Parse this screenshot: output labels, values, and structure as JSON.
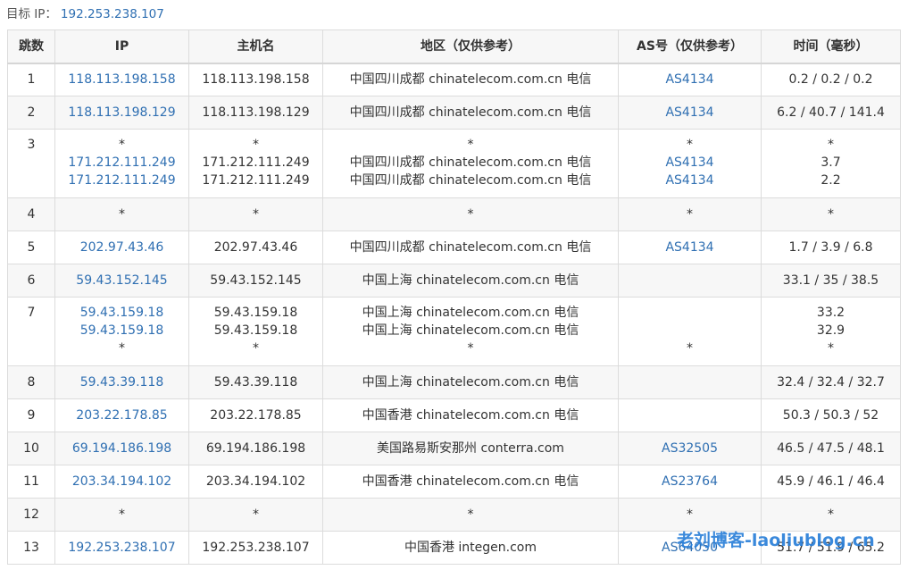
{
  "target": {
    "label": "目标 IP：",
    "ip": "192.253.238.107"
  },
  "headers": [
    "跳数",
    "IP",
    "主机名",
    "地区（仅供参考）",
    "AS号（仅供参考）",
    "时间（毫秒）"
  ],
  "rows": [
    {
      "hop": "1",
      "ip": [
        "118.113.198.158"
      ],
      "host": [
        "118.113.198.158"
      ],
      "region": [
        "中国四川成都 chinatelecom.com.cn 电信"
      ],
      "as": [
        "AS4134"
      ],
      "time": [
        "0.2 / 0.2 / 0.2"
      ]
    },
    {
      "hop": "2",
      "ip": [
        "118.113.198.129"
      ],
      "host": [
        "118.113.198.129"
      ],
      "region": [
        "中国四川成都 chinatelecom.com.cn 电信"
      ],
      "as": [
        "AS4134"
      ],
      "time": [
        "6.2 / 40.7 / 141.4"
      ]
    },
    {
      "hop": "3",
      "ip": [
        "*",
        "171.212.111.249",
        "171.212.111.249"
      ],
      "host": [
        "*",
        "171.212.111.249",
        "171.212.111.249"
      ],
      "region": [
        "*",
        "中国四川成都 chinatelecom.com.cn 电信",
        "中国四川成都 chinatelecom.com.cn 电信"
      ],
      "as": [
        "*",
        "AS4134",
        "AS4134"
      ],
      "time": [
        "*",
        "3.7",
        "2.2"
      ]
    },
    {
      "hop": "4",
      "ip": [
        "*"
      ],
      "host": [
        "*"
      ],
      "region": [
        "*"
      ],
      "as": [
        "*"
      ],
      "time": [
        "*"
      ]
    },
    {
      "hop": "5",
      "ip": [
        "202.97.43.46"
      ],
      "host": [
        "202.97.43.46"
      ],
      "region": [
        "中国四川成都 chinatelecom.com.cn 电信"
      ],
      "as": [
        "AS4134"
      ],
      "time": [
        "1.7 / 3.9 / 6.8"
      ]
    },
    {
      "hop": "6",
      "ip": [
        "59.43.152.145"
      ],
      "host": [
        "59.43.152.145"
      ],
      "region": [
        "中国上海 chinatelecom.com.cn 电信"
      ],
      "as": [
        ""
      ],
      "time": [
        "33.1 / 35 / 38.5"
      ]
    },
    {
      "hop": "7",
      "ip": [
        "59.43.159.18",
        "59.43.159.18",
        "*"
      ],
      "host": [
        "59.43.159.18",
        "59.43.159.18",
        "*"
      ],
      "region": [
        "中国上海 chinatelecom.com.cn 电信",
        "中国上海 chinatelecom.com.cn 电信",
        "*"
      ],
      "as": [
        "",
        "",
        "*"
      ],
      "time": [
        "33.2",
        "32.9",
        "*"
      ]
    },
    {
      "hop": "8",
      "ip": [
        "59.43.39.118"
      ],
      "host": [
        "59.43.39.118"
      ],
      "region": [
        "中国上海 chinatelecom.com.cn 电信"
      ],
      "as": [
        ""
      ],
      "time": [
        "32.4 / 32.4 / 32.7"
      ]
    },
    {
      "hop": "9",
      "ip": [
        "203.22.178.85"
      ],
      "host": [
        "203.22.178.85"
      ],
      "region": [
        "中国香港 chinatelecom.com.cn 电信"
      ],
      "as": [
        ""
      ],
      "time": [
        "50.3 / 50.3 / 52"
      ]
    },
    {
      "hop": "10",
      "ip": [
        "69.194.186.198"
      ],
      "host": [
        "69.194.186.198"
      ],
      "region": [
        "美国路易斯安那州 conterra.com"
      ],
      "as": [
        "AS32505"
      ],
      "time": [
        "46.5 / 47.5 / 48.1"
      ]
    },
    {
      "hop": "11",
      "ip": [
        "203.34.194.102"
      ],
      "host": [
        "203.34.194.102"
      ],
      "region": [
        "中国香港 chinatelecom.com.cn 电信"
      ],
      "as": [
        "AS23764"
      ],
      "time": [
        "45.9 / 46.1 / 46.4"
      ]
    },
    {
      "hop": "12",
      "ip": [
        "*"
      ],
      "host": [
        "*"
      ],
      "region": [
        "*"
      ],
      "as": [
        "*"
      ],
      "time": [
        "*"
      ]
    },
    {
      "hop": "13",
      "ip": [
        "192.253.238.107"
      ],
      "host": [
        "192.253.238.107"
      ],
      "region": [
        "中国香港 integen.com"
      ],
      "as": [
        "AS64050"
      ],
      "time": [
        "51.7 / 51.9 / 65.2"
      ]
    }
  ],
  "watermark": "老刘博客-laoliublog.cn"
}
